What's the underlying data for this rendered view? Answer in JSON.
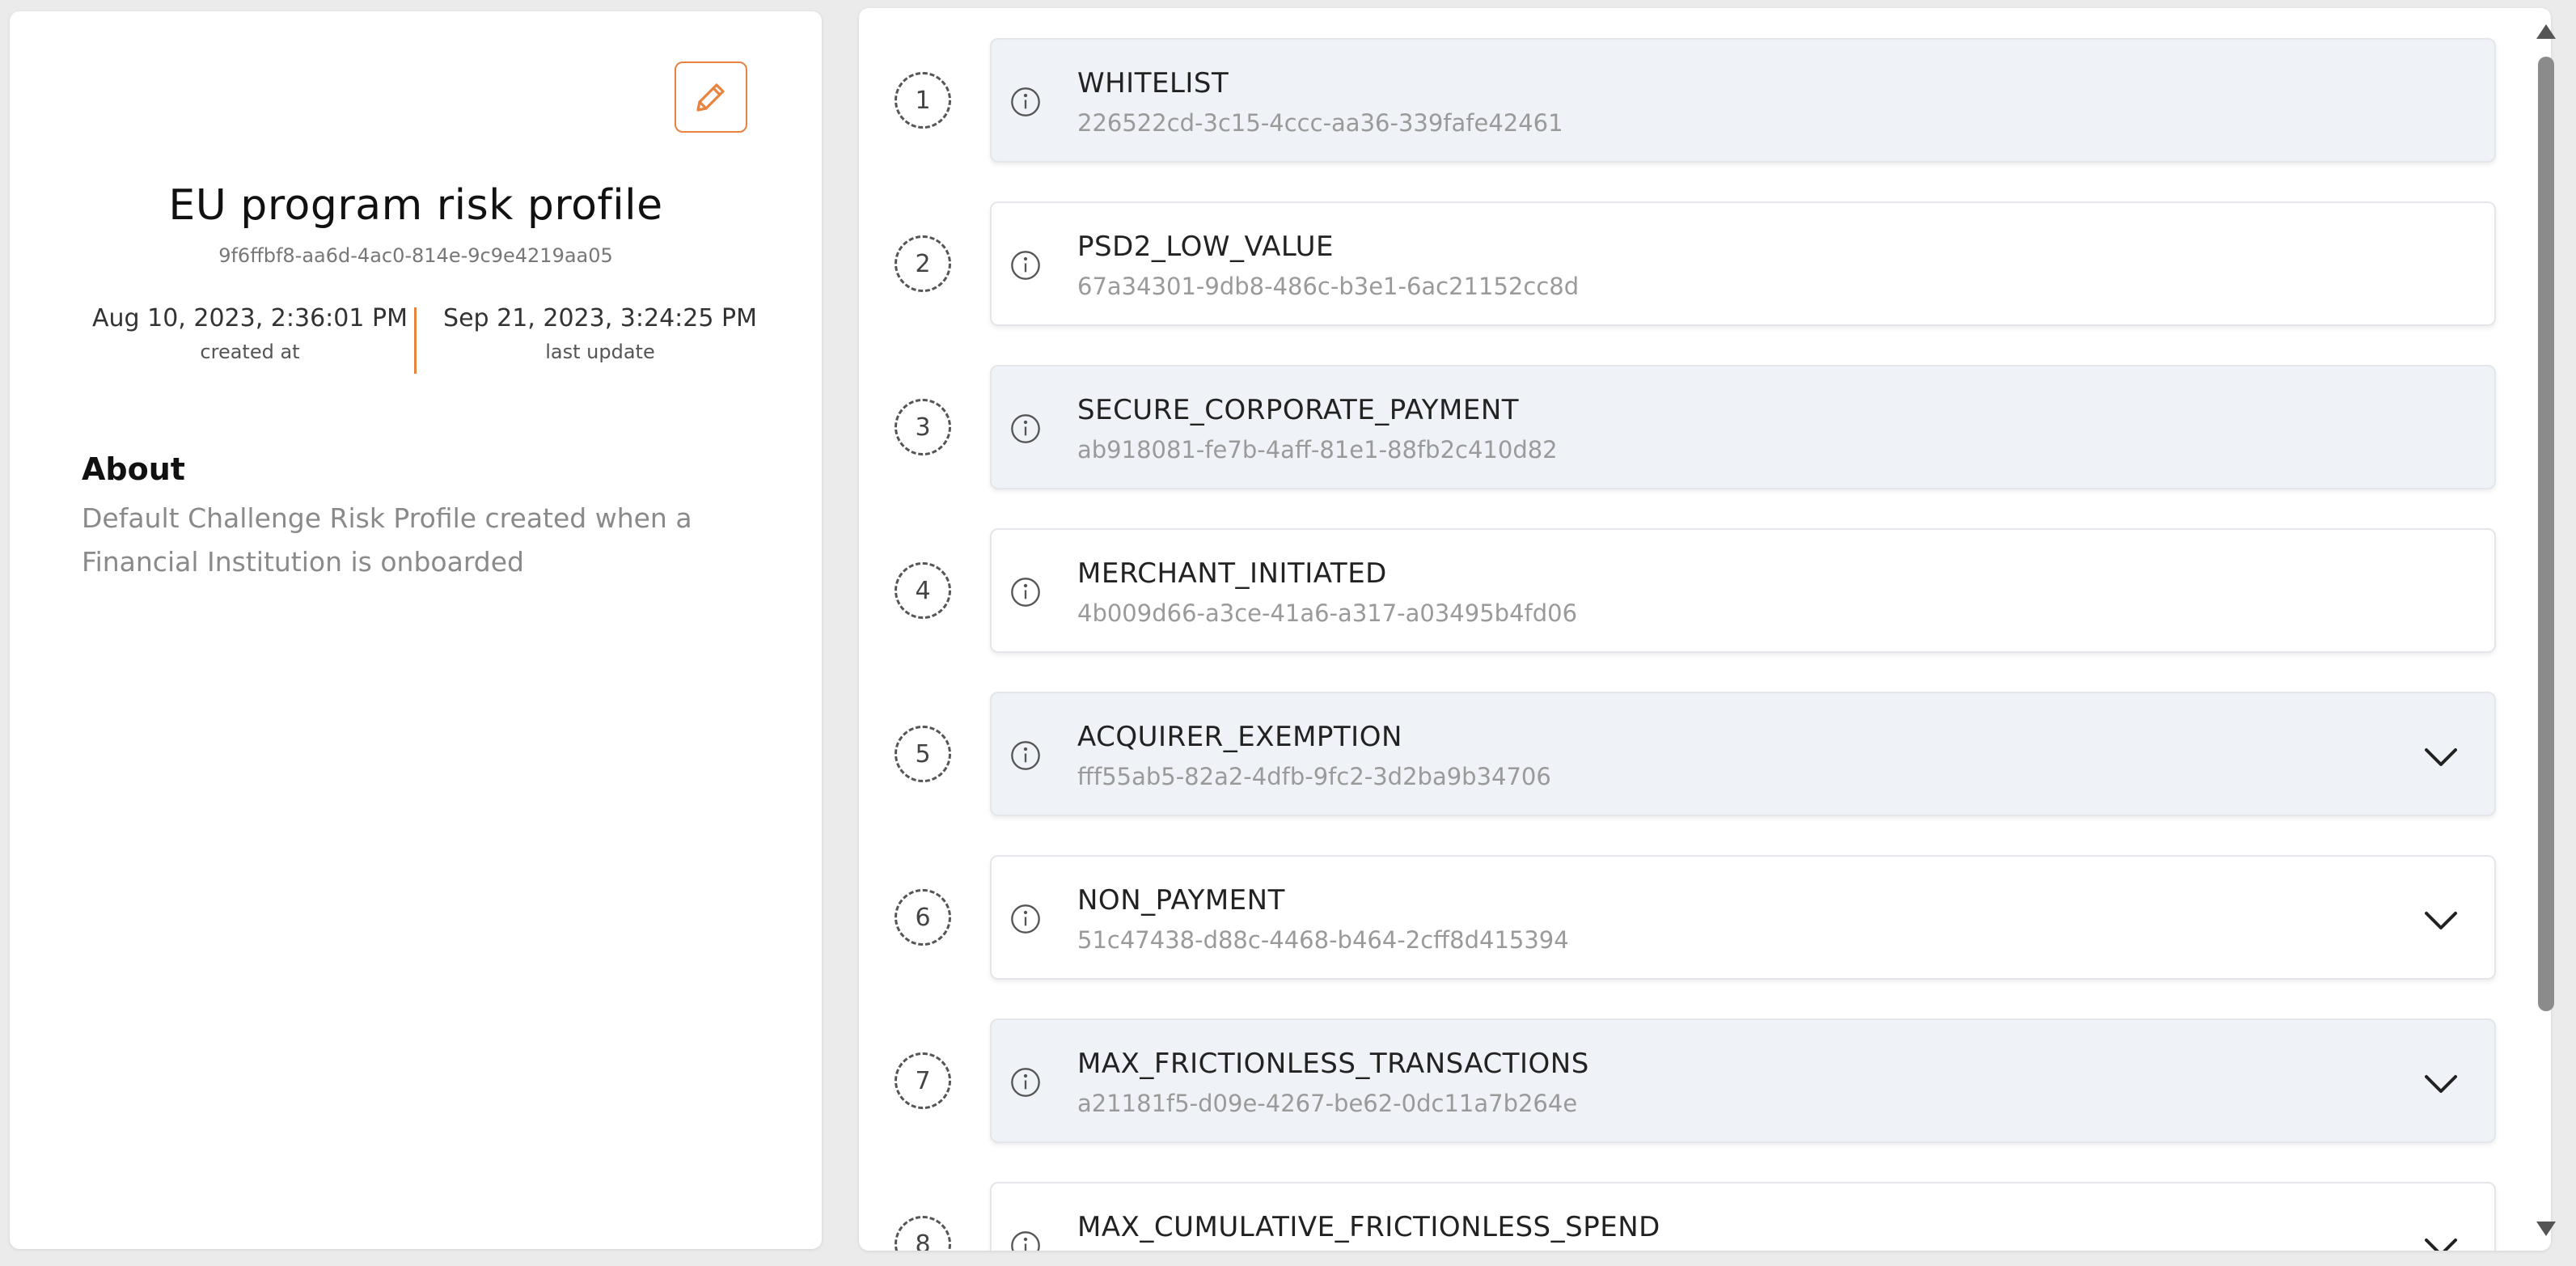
{
  "profile": {
    "title": "EU program risk profile",
    "id": "9f6ffbf8-aa6d-4ac0-814e-9c9e4219aa05",
    "created_at": "Aug 10, 2023, 2:36:01 PM",
    "created_at_label": "created at",
    "updated_at": "Sep 21, 2023, 3:24:25 PM",
    "updated_at_label": "last update",
    "about_title": "About",
    "about_text": "Default Challenge Risk Profile created when a Financial Institution is onboarded",
    "edit_icon": "pencil-icon"
  },
  "colors": {
    "accent": "#e8823f",
    "card_shaded": "#eff2f7",
    "card_plain": "#ffffff",
    "muted_text": "#9a9a9a"
  },
  "rules": [
    {
      "index": "1",
      "name": "WHITELIST",
      "id": "226522cd-3c15-4ccc-aa36-339fafe42461",
      "expandable": false
    },
    {
      "index": "2",
      "name": "PSD2_LOW_VALUE",
      "id": "67a34301-9db8-486c-b3e1-6ac21152cc8d",
      "expandable": false
    },
    {
      "index": "3",
      "name": "SECURE_CORPORATE_PAYMENT",
      "id": "ab918081-fe7b-4aff-81e1-88fb2c410d82",
      "expandable": false
    },
    {
      "index": "4",
      "name": "MERCHANT_INITIATED",
      "id": "4b009d66-a3ce-41a6-a317-a03495b4fd06",
      "expandable": false
    },
    {
      "index": "5",
      "name": "ACQUIRER_EXEMPTION",
      "id": "fff55ab5-82a2-4dfb-9fc2-3d2ba9b34706",
      "expandable": true
    },
    {
      "index": "6",
      "name": "NON_PAYMENT",
      "id": "51c47438-d88c-4468-b464-2cff8d415394",
      "expandable": true
    },
    {
      "index": "7",
      "name": "MAX_FRICTIONLESS_TRANSACTIONS",
      "id": "a21181f5-d09e-4267-be62-0dc11a7b264e",
      "expandable": true
    },
    {
      "index": "8",
      "name": "MAX_CUMULATIVE_FRICTIONLESS_SPEND",
      "id": "",
      "expandable": true
    }
  ]
}
